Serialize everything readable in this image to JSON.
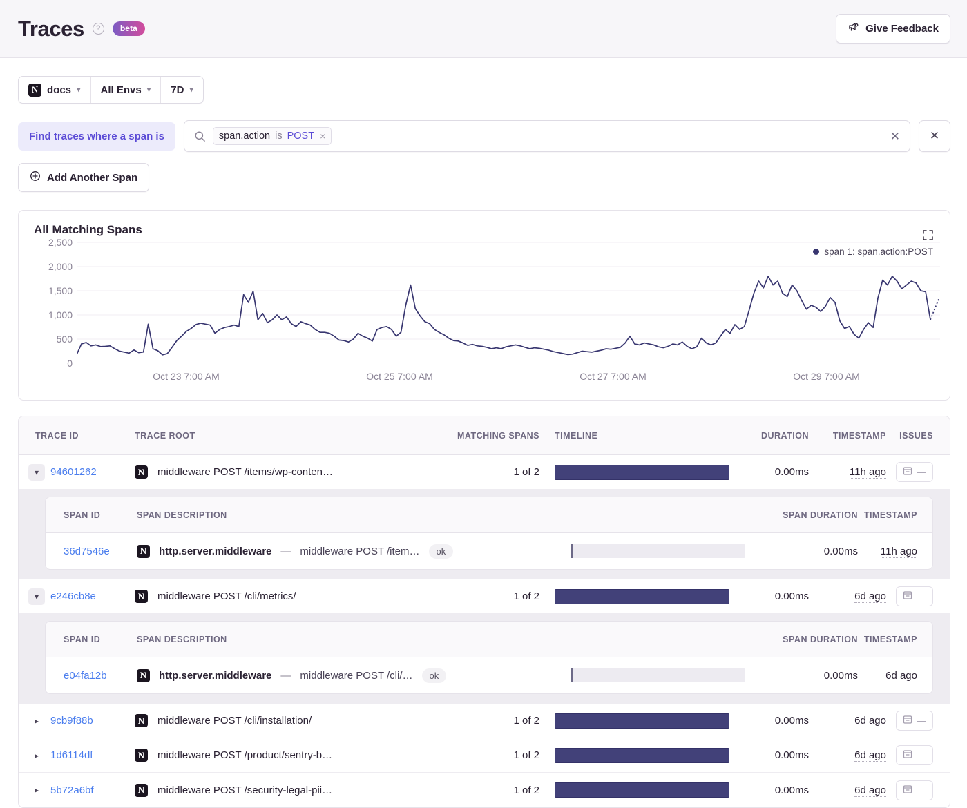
{
  "header": {
    "title": "Traces",
    "help_icon": "question-circle-icon",
    "badge": "beta",
    "feedback_label": "Give Feedback",
    "feedback_icon": "megaphone-icon"
  },
  "filters": {
    "project": "docs",
    "project_icon": "N",
    "environment": "All Envs",
    "period": "7D"
  },
  "query": {
    "span_label": "Find traces where a span is",
    "search_icon": "search-icon",
    "token_key": "span.action",
    "token_op": "is",
    "token_value": "POST",
    "token_remove": "×",
    "clear_search": "✕",
    "clear_all": "✕",
    "add_span_label": "Add Another Span",
    "add_span_icon": "plus-circle-icon"
  },
  "chart_data": {
    "type": "line",
    "title": "All Matching Spans",
    "xlabel": "",
    "ylabel": "",
    "ylim": [
      0,
      2500
    ],
    "yticks": [
      0,
      500,
      1000,
      1500,
      2000,
      2500
    ],
    "ytick_labels": [
      "0",
      "500",
      "1,000",
      "1,500",
      "2,000",
      "2,500"
    ],
    "xtick_labels": [
      "Oct 23 7:00 AM",
      "Oct 25 7:00 AM",
      "Oct 27 7:00 AM",
      "Oct 29 7:00 AM"
    ],
    "grid": true,
    "legend_position": "top-right",
    "series": [
      {
        "name": "span 1: span.action:POST",
        "color": "#383670",
        "values": [
          180,
          400,
          430,
          360,
          380,
          345,
          350,
          360,
          300,
          250,
          230,
          210,
          275,
          220,
          235,
          810,
          300,
          260,
          175,
          200,
          330,
          470,
          560,
          660,
          720,
          800,
          830,
          810,
          790,
          620,
          700,
          740,
          760,
          790,
          760,
          1420,
          1260,
          1490,
          900,
          1030,
          840,
          900,
          1000,
          900,
          960,
          820,
          760,
          860,
          820,
          790,
          700,
          640,
          640,
          620,
          560,
          480,
          470,
          440,
          500,
          620,
          560,
          520,
          460,
          700,
          740,
          760,
          700,
          560,
          640,
          1200,
          1620,
          1130,
          980,
          860,
          820,
          700,
          640,
          590,
          520,
          470,
          460,
          420,
          370,
          390,
          360,
          350,
          330,
          300,
          320,
          300,
          340,
          360,
          380,
          360,
          330,
          300,
          320,
          310,
          290,
          270,
          240,
          220,
          200,
          180,
          190,
          220,
          250,
          240,
          230,
          250,
          270,
          300,
          290,
          310,
          330,
          420,
          560,
          400,
          380,
          420,
          400,
          380,
          340,
          320,
          350,
          400,
          380,
          440,
          350,
          300,
          340,
          520,
          420,
          380,
          420,
          560,
          700,
          620,
          800,
          700,
          760,
          1100,
          1450,
          1700,
          1560,
          1800,
          1620,
          1700,
          1450,
          1380,
          1620,
          1500,
          1300,
          1120,
          1200,
          1160,
          1070,
          1180,
          1360,
          1260,
          880,
          720,
          760,
          600,
          520,
          700,
          840,
          740,
          1350,
          1720,
          1620,
          1800,
          1700,
          1540,
          1620,
          1700,
          1660,
          1500,
          1480,
          900
        ]
      }
    ]
  },
  "table": {
    "columns": [
      "TRACE ID",
      "TRACE ROOT",
      "MATCHING SPANS",
      "TIMELINE",
      "DURATION",
      "TIMESTAMP",
      "ISSUES"
    ],
    "span_columns": [
      "SPAN ID",
      "SPAN DESCRIPTION",
      "SPAN DURATION",
      "TIMESTAMP"
    ],
    "rows": [
      {
        "trace_id": "94601262",
        "expanded": true,
        "root": "middleware POST /items/wp-conten…",
        "matching": "1 of 2",
        "duration": "0.00ms",
        "timestamp": "11h ago",
        "issues": "—",
        "span": {
          "span_id": "36d7546e",
          "op": "http.server.middleware",
          "dash": "—",
          "detail": "middleware POST /item…",
          "status": "ok",
          "duration": "0.00ms",
          "timestamp": "11h ago"
        }
      },
      {
        "trace_id": "e246cb8e",
        "expanded": true,
        "root": "middleware POST /cli/metrics/",
        "matching": "1 of 2",
        "duration": "0.00ms",
        "timestamp": "6d ago",
        "issues": "—",
        "span": {
          "span_id": "e04fa12b",
          "op": "http.server.middleware",
          "dash": "—",
          "detail": "middleware POST /cli/…",
          "status": "ok",
          "duration": "0.00ms",
          "timestamp": "6d ago"
        }
      },
      {
        "trace_id": "9cb9f88b",
        "expanded": false,
        "root": "middleware POST /cli/installation/",
        "matching": "1 of 2",
        "duration": "0.00ms",
        "timestamp": "6d ago",
        "issues": "—"
      },
      {
        "trace_id": "1d6114df",
        "expanded": false,
        "root": "middleware POST /product/sentry-b…",
        "matching": "1 of 2",
        "duration": "0.00ms",
        "timestamp": "6d ago",
        "issues": "—"
      },
      {
        "trace_id": "5b72a6bf",
        "expanded": false,
        "root": "middleware POST /security-legal-pii…",
        "matching": "1 of 2",
        "duration": "0.00ms",
        "timestamp": "6d ago",
        "issues": "—"
      }
    ]
  }
}
